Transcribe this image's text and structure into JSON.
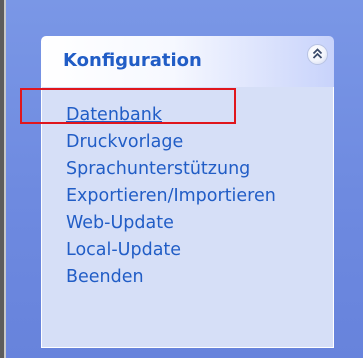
{
  "panel": {
    "title": "Konfiguration",
    "collapse_icon": "double-chevron-up-icon",
    "items": [
      {
        "label": "Datenbank"
      },
      {
        "label": "Druckvorlage"
      },
      {
        "label": "Sprachunterstützung"
      },
      {
        "label": "Exportieren/Importieren"
      },
      {
        "label": "Web-Update"
      },
      {
        "label": "Local-Update"
      },
      {
        "label": "Beenden"
      }
    ]
  },
  "colors": {
    "link": "#215dc6",
    "panel_body": "#d6dff7",
    "background": "#6e8ae0",
    "highlight": "#e0161d"
  }
}
